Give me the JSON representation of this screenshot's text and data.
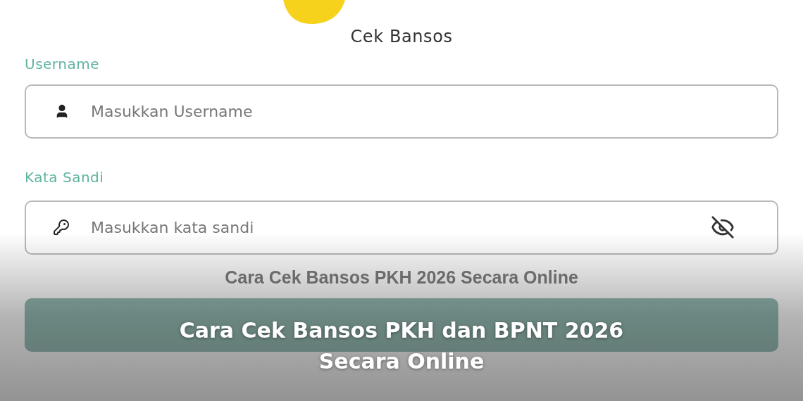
{
  "app_title": "Cek Bansos",
  "username": {
    "label": "Username",
    "placeholder": "Masukkan Username"
  },
  "password": {
    "label": "Kata Sandi",
    "placeholder": "Masukkan kata sandi",
    "hidden": true
  },
  "overlay": {
    "subtitle": "Cara Cek Bansos PKH 2026 Secara Online",
    "headline": "Cara Cek Bansos PKH dan BPNT 2026 Secara Online"
  }
}
